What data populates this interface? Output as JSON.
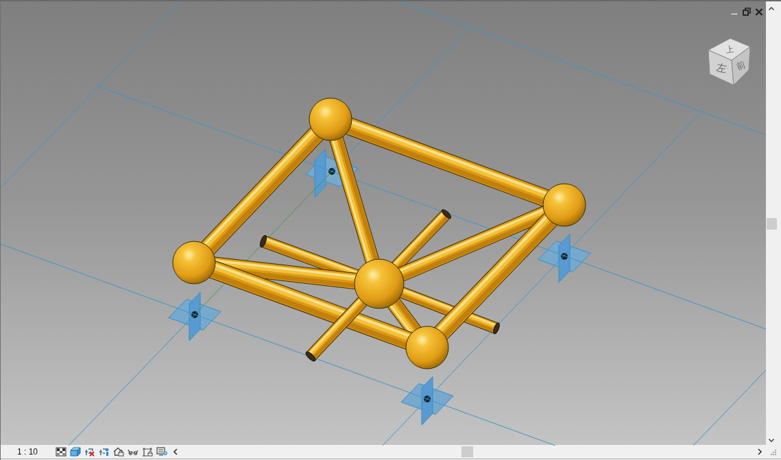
{
  "viewport": {
    "view_cube": {
      "faces": [
        {
          "kind": "top",
          "label": "上"
        },
        {
          "kind": "left",
          "label": "左"
        },
        {
          "kind": "front",
          "label": "前"
        }
      ]
    }
  },
  "status_bar": {
    "scale": "1 : 10"
  }
}
